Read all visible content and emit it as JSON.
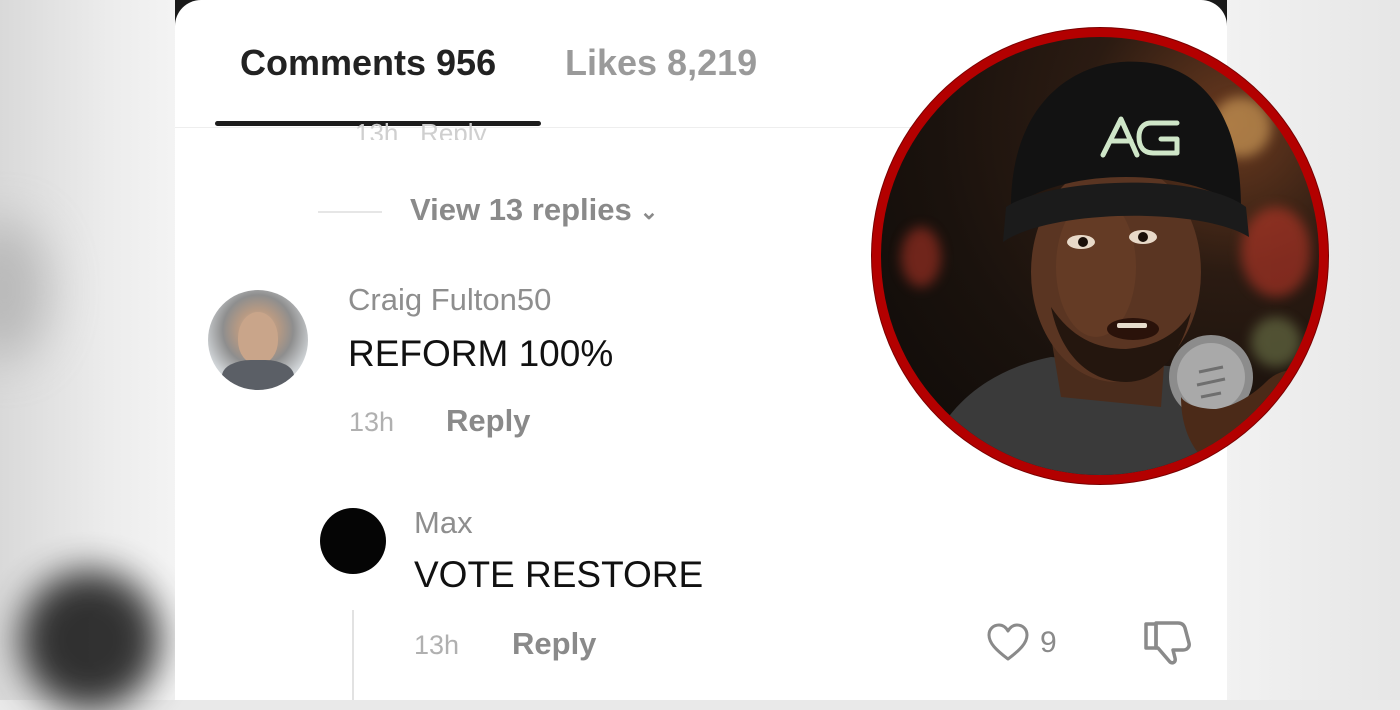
{
  "tabs": {
    "comments_label": "Comments 956",
    "likes_label": "Likes 8,219"
  },
  "thread": {
    "view_replies_label": "View 13 replies",
    "chevron": "⌄"
  },
  "comments": [
    {
      "username": "Craig Fulton50",
      "text": "REFORM 100%",
      "time": "13h",
      "reply_label": "Reply"
    },
    {
      "username": "Max",
      "text": "VOTE RESTORE",
      "time": "13h",
      "reply_label": "Reply",
      "like_count": "9"
    }
  ],
  "photo": {
    "hat_logo": "AG",
    "border_color": "#b30000"
  },
  "icons": {
    "like": "heart-outline-icon",
    "dislike": "thumbs-down-icon",
    "chevron": "chevron-down-icon"
  }
}
